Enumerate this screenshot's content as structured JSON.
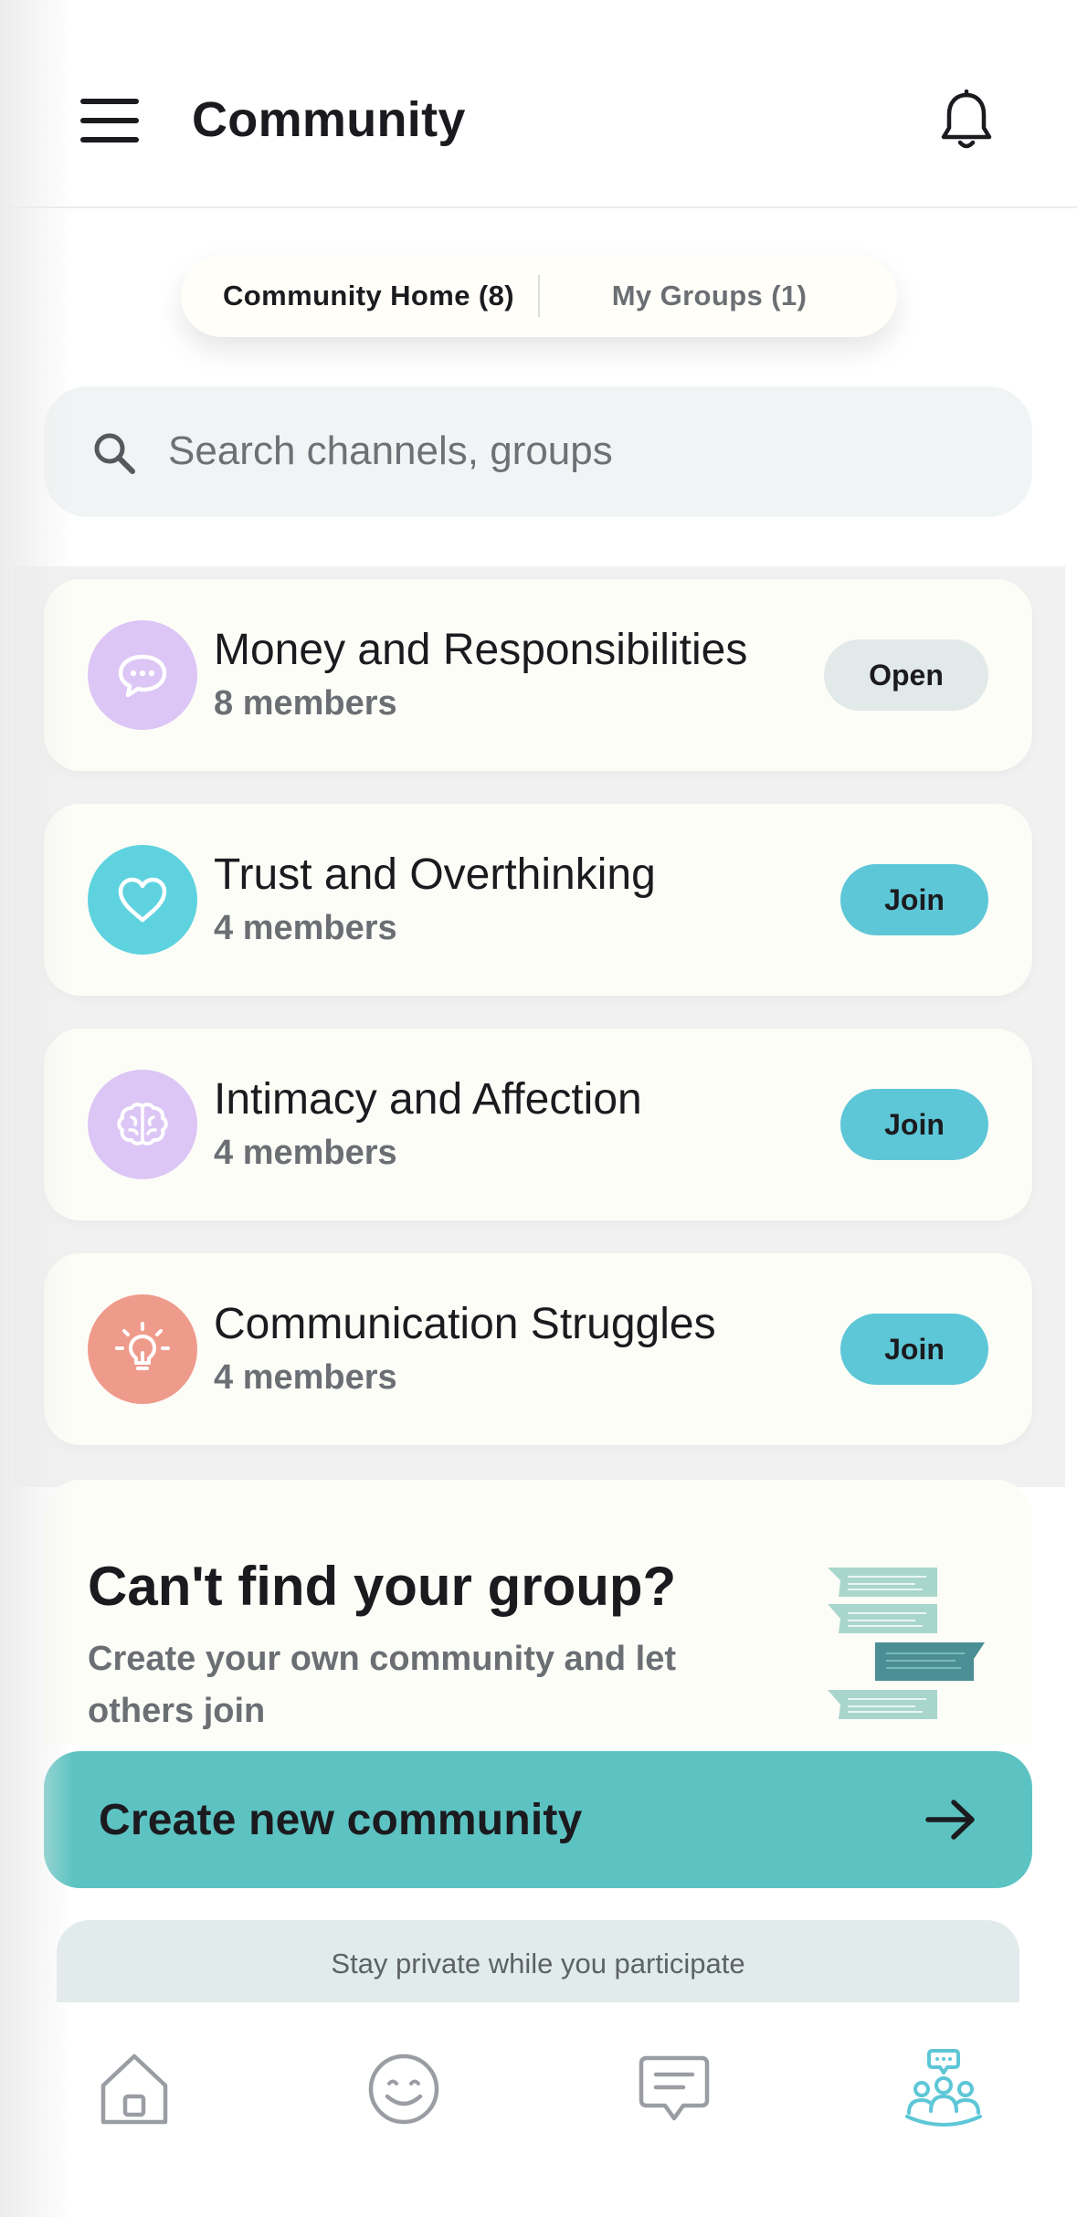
{
  "header": {
    "title": "Community",
    "menu_icon": "hamburger-menu-icon",
    "bell_icon": "bell-icon"
  },
  "tabs": [
    {
      "label": "Community Home (8)",
      "active": true
    },
    {
      "label": "My Groups (1)",
      "active": false
    }
  ],
  "search": {
    "placeholder": "Search channels, groups",
    "value": "",
    "icon": "search-icon"
  },
  "groups": [
    {
      "name": "Money and Responsibilities",
      "members": "8 members",
      "action": "Open",
      "icon": "chat-bubble-icon",
      "color": "#dcc6f5"
    },
    {
      "name": "Trust and Overthinking",
      "members": "4 members",
      "action": "Join",
      "icon": "heart-icon",
      "color": "#5ed3df"
    },
    {
      "name": "Intimacy and Affection",
      "members": "4 members",
      "action": "Join",
      "icon": "brain-icon",
      "color": "#dcc6f5"
    },
    {
      "name": "Communication Struggles",
      "members": "4 members",
      "action": "Join",
      "icon": "lightbulb-icon",
      "color": "#ef9b8c"
    }
  ],
  "promo": {
    "title": "Can't find your group?",
    "text": "Create your own community and let others join",
    "art": "chat-bubbles-illustration"
  },
  "cta": {
    "label": "Create new community",
    "icon": "arrow-right-icon"
  },
  "privacy_note": "Stay private while you participate",
  "bottom_nav": [
    {
      "name": "home",
      "icon": "home-icon",
      "active": false
    },
    {
      "name": "mood",
      "icon": "smiley-icon",
      "active": false
    },
    {
      "name": "messages",
      "icon": "message-icon",
      "active": false
    },
    {
      "name": "community",
      "icon": "community-icon",
      "active": true
    }
  ],
  "colors": {
    "accent": "#5ec7d7",
    "cta": "#5cc3c2",
    "active_nav": "#5ec7d7",
    "inactive_nav": "#9a9da3"
  }
}
